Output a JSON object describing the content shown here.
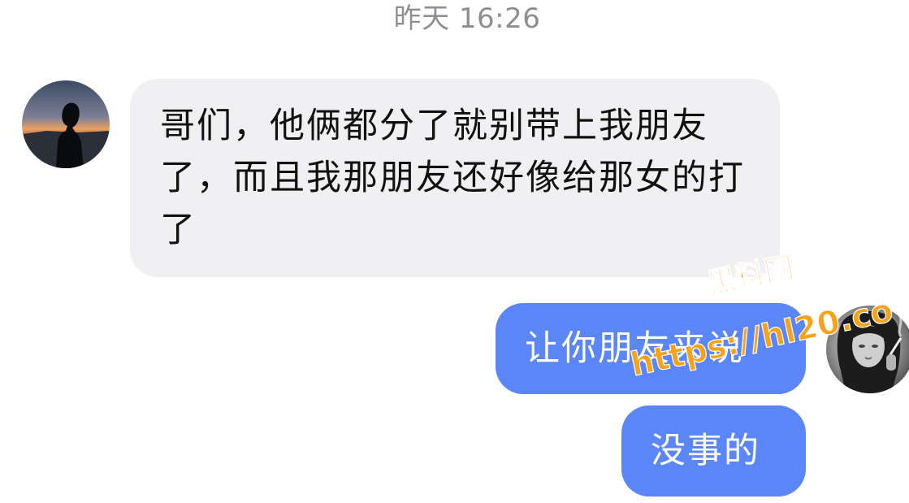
{
  "header": {
    "timestamp": "昨天 16:26"
  },
  "messages": [
    {
      "sender": "other",
      "avatar_icon": "silhouette-sunset-avatar",
      "text": "哥们，他俩都分了就别带上我朋友了，而且我那朋友还好像给那女的打了"
    },
    {
      "sender": "self",
      "avatar_icon": "smoking-girl-avatar",
      "text": "让你朋友来说"
    },
    {
      "sender": "self",
      "text": "没事的"
    }
  ],
  "watermark": {
    "line1": "黑料网",
    "line2": "https://hl20.co"
  },
  "colors": {
    "incoming_bubble": "#f0f0f2",
    "outgoing_bubble": "#5a86f7",
    "timestamp": "#8e8e93",
    "watermark": "#f6a31b"
  }
}
